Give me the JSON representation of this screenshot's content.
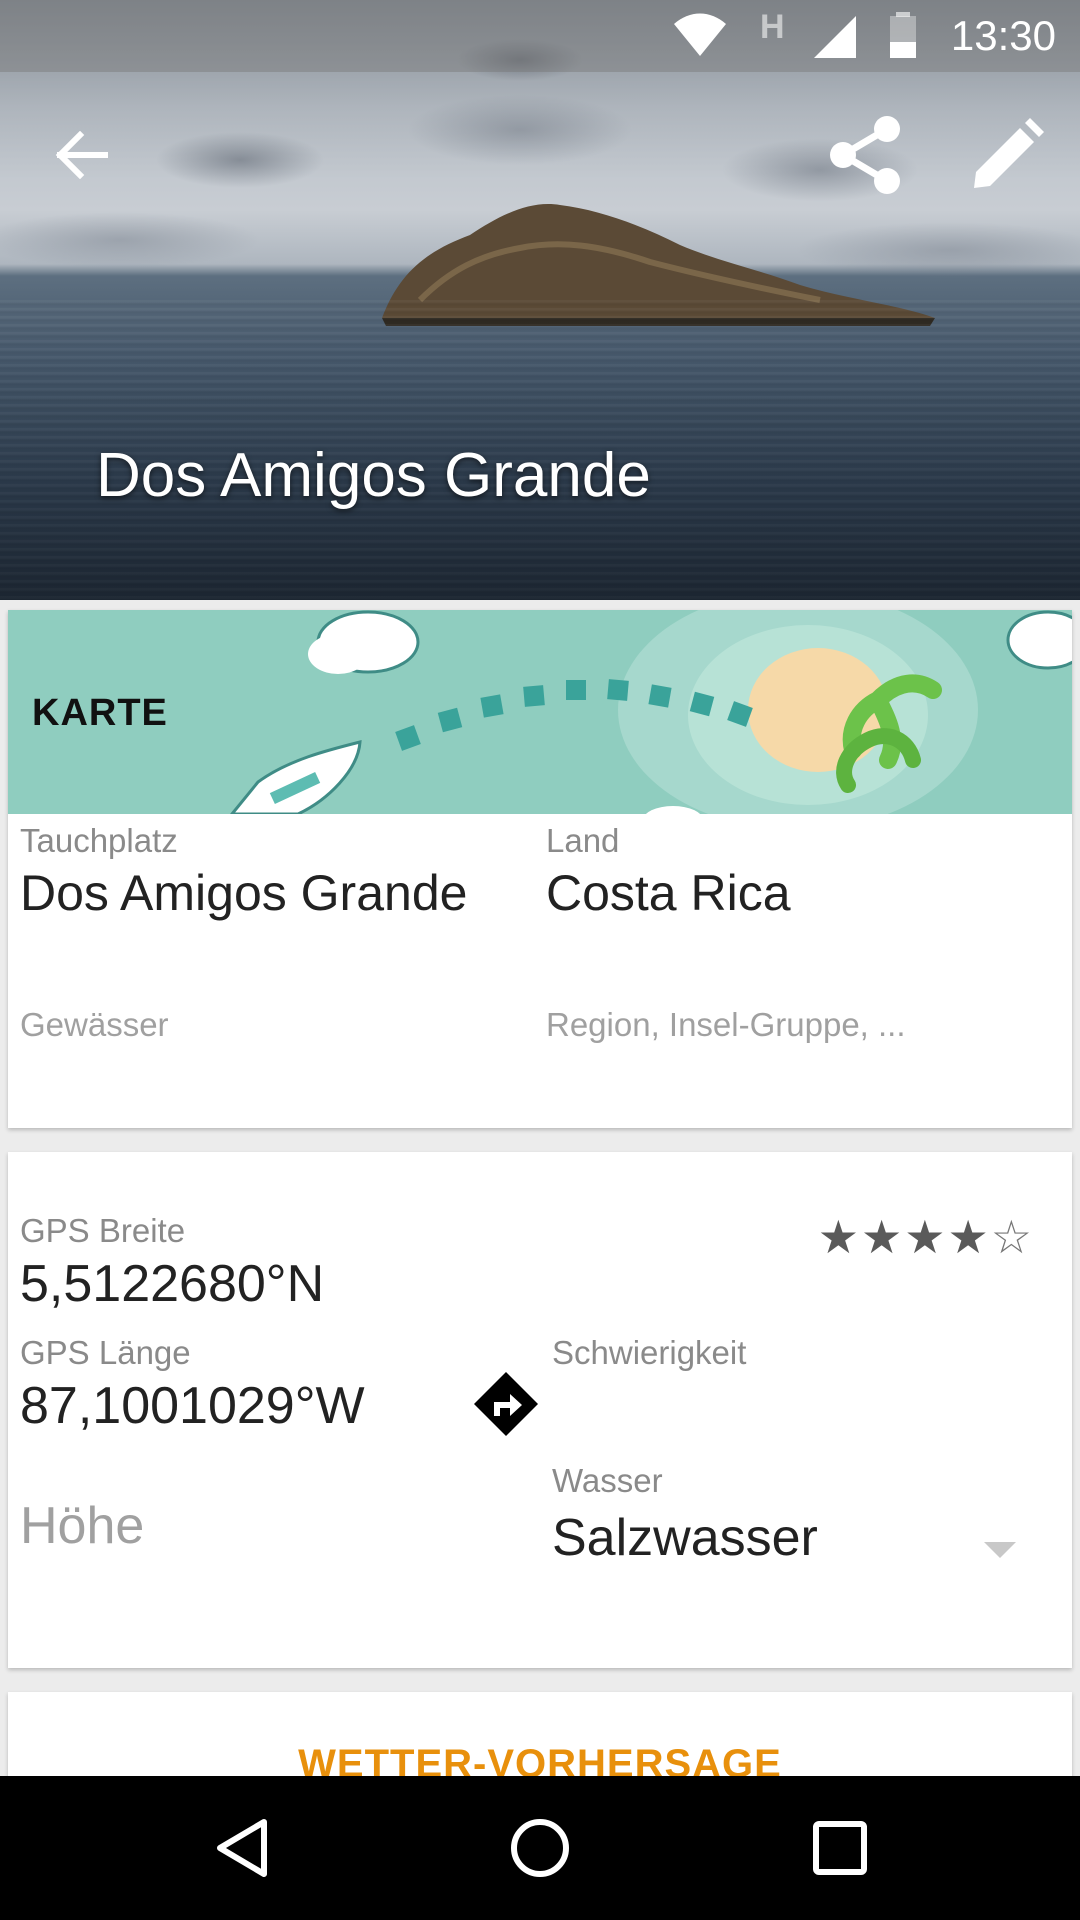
{
  "status_bar": {
    "time": "13:30",
    "network_label": "H",
    "icons": [
      "wifi-icon",
      "signal-icon",
      "battery-icon"
    ]
  },
  "hero": {
    "title": "Dos Amigos Grande",
    "actions": [
      "back-icon",
      "share-icon",
      "edit-icon"
    ]
  },
  "map_card": {
    "banner_label": "KARTE",
    "dive_site_label": "Tauchplatz",
    "dive_site_value": "Dos Amigos Grande",
    "country_label": "Land",
    "country_value": "Costa Rica",
    "water_body_placeholder": "Gewässer",
    "region_placeholder": "Region, Insel-Gruppe, ..."
  },
  "gps_card": {
    "lat_label": "GPS Breite",
    "lat_value": "5,5122680°N",
    "lon_label": "GPS Länge",
    "lon_value": "87,1001029°W",
    "altitude_placeholder": "Höhe",
    "rating": {
      "filled": 4,
      "max": 5
    },
    "difficulty_label": "Schwierigkeit",
    "water_label": "Wasser",
    "water_value": "Salzwasser"
  },
  "weather_card": {
    "label": "WETTER-VORHERSAGE"
  },
  "colors": {
    "accent": "#e8900c",
    "map_banner": "#8fcdbf",
    "card": "#ffffff",
    "background": "#ececec"
  }
}
